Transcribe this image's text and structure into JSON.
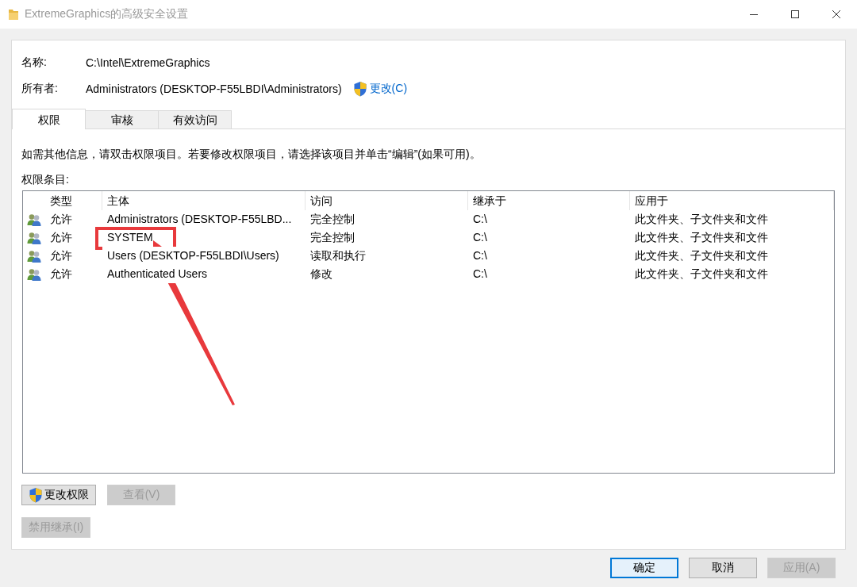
{
  "window": {
    "title": "ExtremeGraphics的高级安全设置"
  },
  "fields": [
    {
      "label": "名称:",
      "value": "C:\\Intel\\ExtremeGraphics"
    },
    {
      "label": "所有者:",
      "value": "Administrators (DESKTOP-F55LBDI\\Administrators)",
      "link": "更改(C)"
    }
  ],
  "tabs": [
    {
      "label": "权限",
      "selected": true
    },
    {
      "label": "审核",
      "selected": false
    },
    {
      "label": "有效访问",
      "selected": false
    }
  ],
  "info": "如需其他信息，请双击权限项目。若要修改权限项目，请选择该项目并单击“编辑”(如果可用)。",
  "list_label": "权限条目:",
  "table": {
    "columns": [
      "类型",
      "主体",
      "访问",
      "继承于",
      "应用于"
    ],
    "rows": [
      {
        "cells": [
          "允许",
          "Administrators (DESKTOP-F55LBD...",
          "完全控制",
          "C:\\",
          "此文件夹、子文件夹和文件"
        ],
        "marked": false
      },
      {
        "cells": [
          "允许",
          "SYSTEM",
          "完全控制",
          "C:\\",
          "此文件夹、子文件夹和文件"
        ],
        "marked": true
      },
      {
        "cells": [
          "允许",
          "Users (DESKTOP-F55LBDI\\Users)",
          "读取和执行",
          "C:\\",
          "此文件夹、子文件夹和文件"
        ],
        "marked": false
      },
      {
        "cells": [
          "允许",
          "Authenticated Users",
          "修改",
          "C:\\",
          "此文件夹、子文件夹和文件"
        ],
        "marked": false
      }
    ]
  },
  "action_rows": [
    {
      "buttons": [
        {
          "label": "更改权限",
          "shield": true,
          "disabled": false
        },
        {
          "label": "查看(V)",
          "shield": false,
          "disabled": true
        }
      ]
    },
    {
      "buttons": [
        {
          "label": "禁用继承(I)",
          "shield": false,
          "disabled": true
        }
      ]
    }
  ],
  "footer_buttons": [
    {
      "label": "确定",
      "default": true,
      "disabled": false
    },
    {
      "label": "取消",
      "default": false,
      "disabled": false
    },
    {
      "label": "应用(A)",
      "default": false,
      "disabled": true
    }
  ]
}
